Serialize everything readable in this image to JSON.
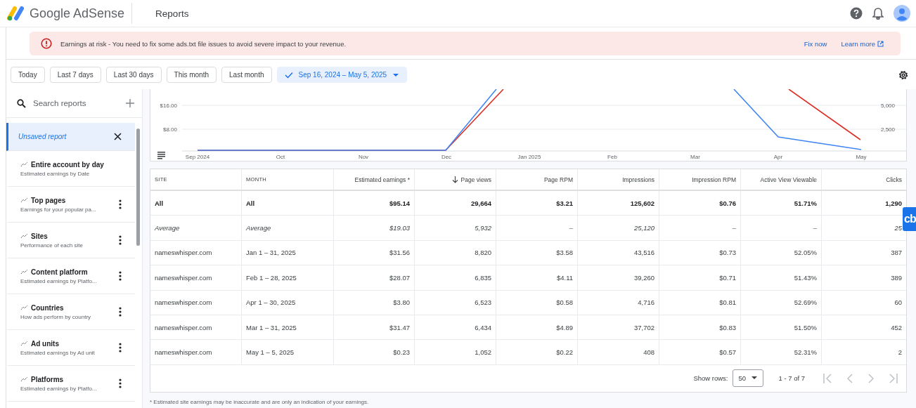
{
  "header": {
    "product": "Google AdSense",
    "page_title": "Reports"
  },
  "banner": {
    "message": "Earnings at risk - You need to fix some ads.txt file issues to avoid severe impact to your revenue.",
    "actions": [
      "Fix now",
      "Learn more"
    ]
  },
  "date_chips": [
    {
      "label": "Today",
      "selected": false
    },
    {
      "label": "Last 7 days",
      "selected": false
    },
    {
      "label": "Last 30 days",
      "selected": false
    },
    {
      "label": "This month",
      "selected": false
    },
    {
      "label": "Last month",
      "selected": false
    },
    {
      "label": "Sep 16, 2024 – May 5, 2025",
      "selected": true
    }
  ],
  "sidebar": {
    "search_placeholder": "Search reports",
    "items": [
      {
        "title": "Unsaved report",
        "selected": true
      },
      {
        "title": "Entire account by day",
        "subtitle": "Estimated earnings by Date",
        "selected": false
      },
      {
        "title": "Top pages",
        "subtitle": "Earnings for your popular pa...",
        "selected": false
      },
      {
        "title": "Sites",
        "subtitle": "Performance of each site",
        "selected": false
      },
      {
        "title": "Content platform",
        "subtitle": "Estimated earnings by Platfo...",
        "selected": false
      },
      {
        "title": "Countries",
        "subtitle": "How ads perform by country",
        "selected": false
      },
      {
        "title": "Ad units",
        "subtitle": "Estimated earnings by Ad unit",
        "selected": false
      },
      {
        "title": "Platforms",
        "subtitle": "Estimated earnings by Platfo...",
        "selected": false
      }
    ]
  },
  "chart": {
    "x_labels": [
      "Sep 2024",
      "Oct",
      "Nov",
      "Dec",
      "Jan 2025",
      "Feb",
      "Mar",
      "Apr",
      "May"
    ],
    "left_labels": [
      "$16.00",
      "$8.00"
    ],
    "right_labels": [
      "5,000",
      "2,500"
    ]
  },
  "table": {
    "columns": [
      {
        "label": "SITE",
        "kind": "text"
      },
      {
        "label": "MONTH",
        "kind": "text"
      },
      {
        "label": "Estimated earnings *",
        "kind": "num"
      },
      {
        "label": "Page views",
        "kind": "sorted"
      },
      {
        "label": "Page RPM",
        "kind": "num"
      },
      {
        "label": "Impressions",
        "kind": "num"
      },
      {
        "label": "Impression RPM",
        "kind": "num"
      },
      {
        "label": "Active View Viewable",
        "kind": "num"
      },
      {
        "label": "Clicks",
        "kind": "num"
      }
    ],
    "rows": [
      {
        "kind": "total",
        "cells": [
          "All",
          "All",
          "$95.14",
          "29,664",
          "$3.21",
          "125,602",
          "$0.76",
          "51.71%",
          "1,290"
        ]
      },
      {
        "kind": "average",
        "cells": [
          "Average",
          "Average",
          "$19.03",
          "5,932",
          "–",
          "25,120",
          "–",
          "–",
          "25"
        ]
      },
      {
        "kind": "data",
        "cells": [
          "nameswhisper.com",
          "Jan 1 – 31, 2025",
          "$31.56",
          "8,820",
          "$3.58",
          "43,516",
          "$0.73",
          "52.05%",
          "387"
        ]
      },
      {
        "kind": "data",
        "cells": [
          "nameswhisper.com",
          "Feb 1 – 28, 2025",
          "$28.07",
          "6,835",
          "$4.11",
          "39,260",
          "$0.71",
          "51.43%",
          "389"
        ]
      },
      {
        "kind": "data",
        "cells": [
          "nameswhisper.com",
          "Apr 1 – 30, 2025",
          "$3.80",
          "6,523",
          "$0.58",
          "4,716",
          "$0.81",
          "52.69%",
          "60"
        ]
      },
      {
        "kind": "data",
        "cells": [
          "nameswhisper.com",
          "Mar 1 – 31, 2025",
          "$31.47",
          "6,434",
          "$4.89",
          "37,702",
          "$0.83",
          "51.50%",
          "452"
        ]
      },
      {
        "kind": "data",
        "cells": [
          "nameswhisper.com",
          "May 1 – 5, 2025",
          "$0.23",
          "1,052",
          "$0.22",
          "408",
          "$0.57",
          "52.31%",
          "2"
        ]
      }
    ],
    "pagination": {
      "label": "Show rows:",
      "rows_per_page": "50",
      "range": "1 - 7 of 7"
    }
  },
  "footnote": "* Estimated site earnings may be inaccurate and are only an indication of your earnings.",
  "overlay_badge": "cb"
}
